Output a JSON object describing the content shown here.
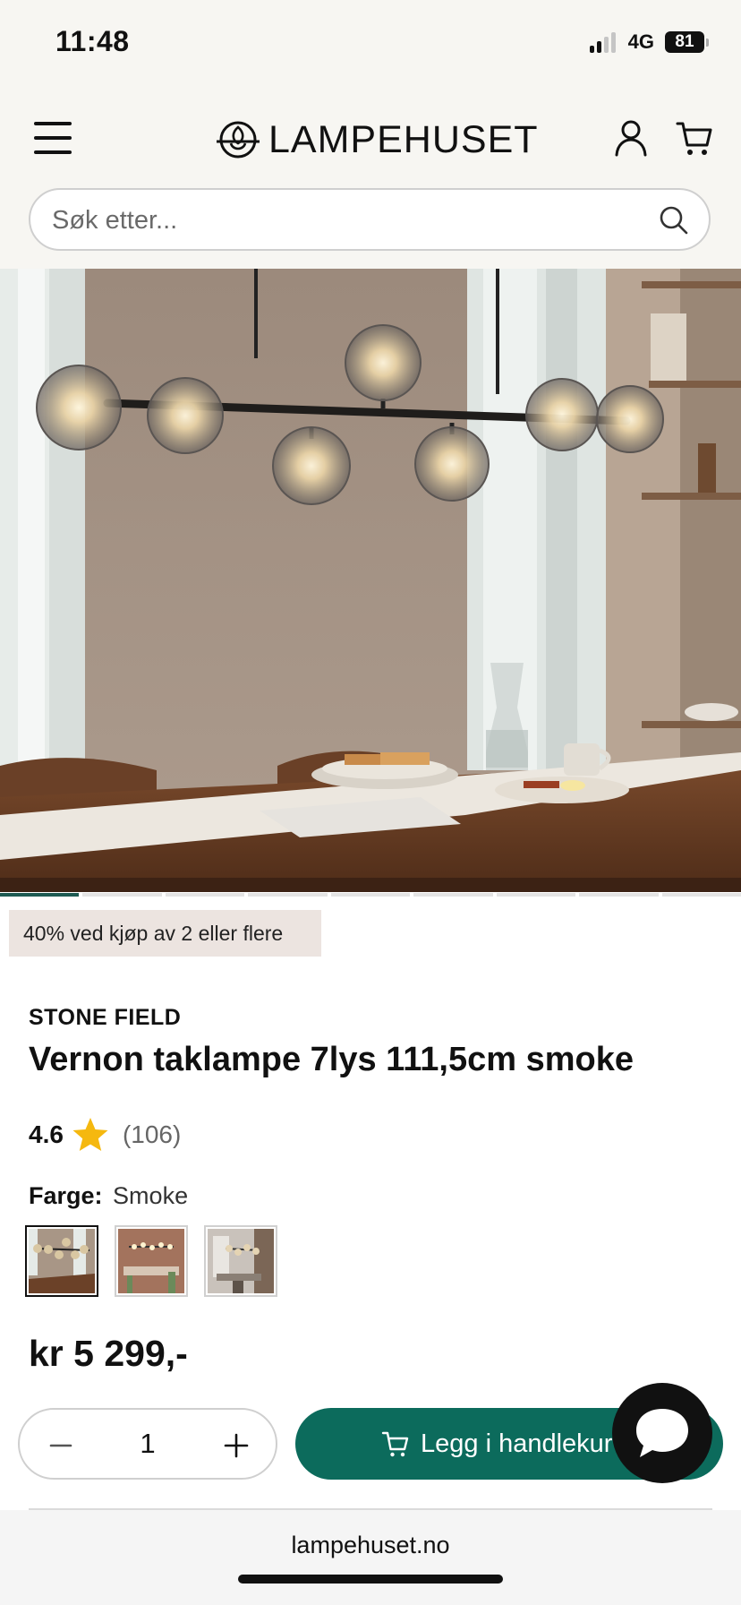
{
  "status_bar": {
    "time": "11:48",
    "network": "4G",
    "battery": "81"
  },
  "header": {
    "logo_text": "LAMPEHUSET",
    "search_placeholder": "Søk etter..."
  },
  "gallery": {
    "slide_count": 9,
    "active_slide": 1
  },
  "promo_badge": "40% ved kjøp av 2 eller flere",
  "product": {
    "brand": "STONE FIELD",
    "title": "Vernon taklampe 7lys 111,5cm smoke",
    "rating": "4.6",
    "review_count": "(106)",
    "color_label": "Farge:",
    "color_value": "Smoke",
    "price": "kr 5 299,-"
  },
  "purchase": {
    "quantity": "1",
    "add_to_cart_label": "Legg i handlekurv"
  },
  "browser": {
    "url": "lampehuset.no"
  },
  "colors": {
    "primary_green": "#0c6b5c",
    "star": "#f5b80f",
    "promo_bg": "#ece4e0",
    "header_bg": "#f7f6f2"
  }
}
